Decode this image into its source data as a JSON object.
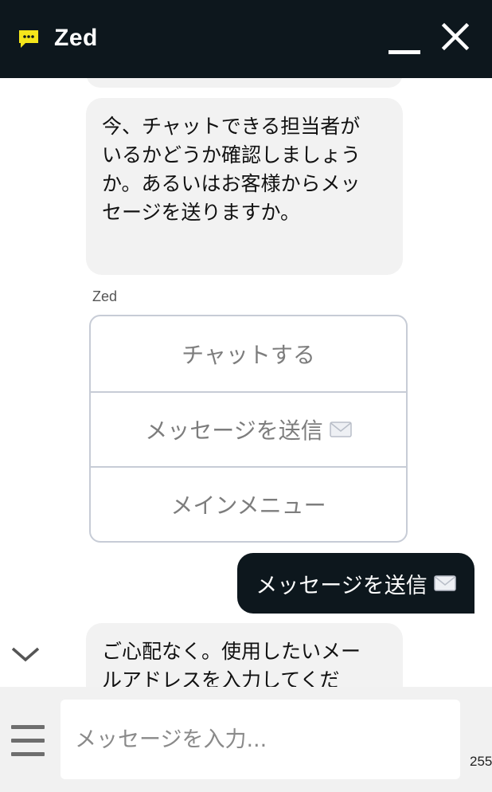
{
  "header": {
    "title": "Zed",
    "accent_color": "#f5e61b",
    "icons": {
      "chat": "chat-bubble-icon",
      "minimize": "minimize-icon",
      "close": "close-icon"
    }
  },
  "conversation": {
    "bot_message_1": "今、チャットできる担当者がいるかどうか確認しましょうか。あるいはお客様からメッセージを送りますか。",
    "sender_name": "Zed",
    "options": [
      {
        "label": "チャットする",
        "icon": ""
      },
      {
        "label": "メッセージを送信",
        "icon": "envelope-icon"
      },
      {
        "label": "メインメニュー",
        "icon": ""
      }
    ],
    "user_message": "メッセージを送信",
    "bot_message_2": "ご心配なく。使用したいメールアドレスを入力してくだ"
  },
  "footer": {
    "input_placeholder": "メッセージを入力...",
    "char_count": "255"
  },
  "colors": {
    "dark": "#0d171d",
    "bubble": "#f2f2f2",
    "footer": "#f1f1f1"
  }
}
